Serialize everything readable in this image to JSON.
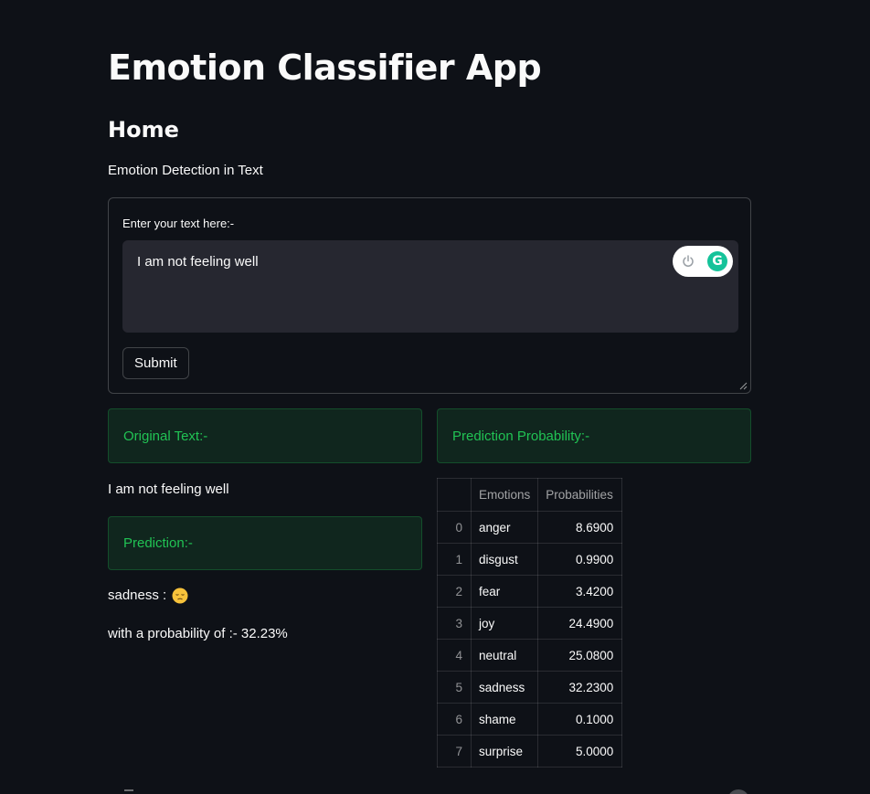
{
  "app": {
    "title": "Emotion Classifier App"
  },
  "page": {
    "heading": "Home",
    "subtitle": "Emotion Detection in Text"
  },
  "form": {
    "label": "Enter your text here:-",
    "text_value": "I am not feeling well",
    "submit_label": "Submit",
    "grammarly_letter": "G"
  },
  "results": {
    "original_header": "Original Text:-",
    "original_text": "I am not feeling well",
    "prediction_header": "Prediction:-",
    "prediction_text": "sadness :",
    "prediction_emoji": "disappointed-face",
    "probability_text": "with a probability of :- 32.23%",
    "probability_header": "Prediction Probability:-"
  },
  "table": {
    "columns": [
      "",
      "Emotions",
      "Probabilities"
    ],
    "rows": [
      {
        "index": "0",
        "emotion": "anger",
        "probability": "8.6900"
      },
      {
        "index": "1",
        "emotion": "disgust",
        "probability": "0.9900"
      },
      {
        "index": "2",
        "emotion": "fear",
        "probability": "3.4200"
      },
      {
        "index": "3",
        "emotion": "joy",
        "probability": "24.4900"
      },
      {
        "index": "4",
        "emotion": "neutral",
        "probability": "25.0800"
      },
      {
        "index": "5",
        "emotion": "sadness",
        "probability": "32.2300"
      },
      {
        "index": "6",
        "emotion": "shame",
        "probability": "0.1000"
      },
      {
        "index": "7",
        "emotion": "surprise",
        "probability": "5.0000"
      }
    ]
  },
  "colors": {
    "background": "#0e1117",
    "success_text": "#21c354",
    "input_bg": "#262730",
    "grammarly": "#15c39a"
  }
}
